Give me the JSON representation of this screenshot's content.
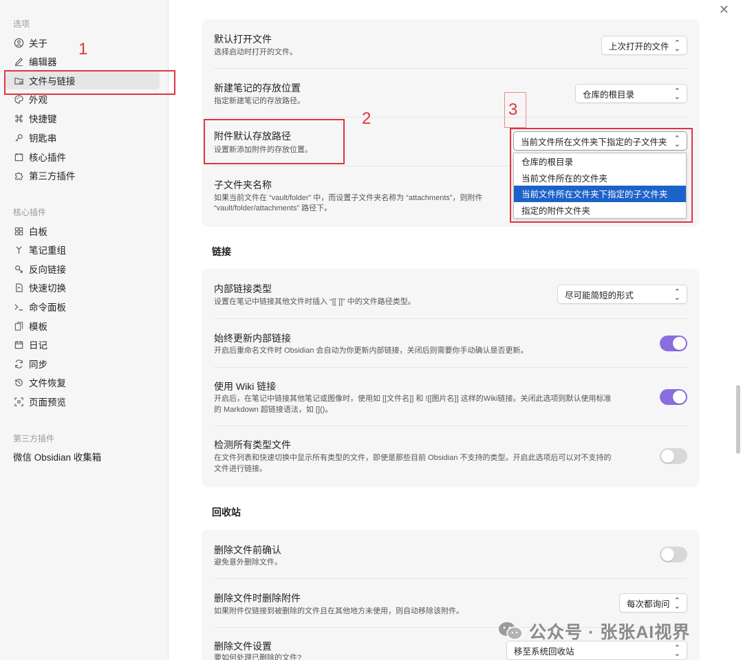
{
  "sidebar": {
    "section_options": "选项",
    "options": [
      {
        "label": "关于",
        "icon": "about-icon"
      },
      {
        "label": "编辑器",
        "icon": "pencil-icon"
      },
      {
        "label": "文件与链接",
        "icon": "folder-link-icon",
        "active": true
      },
      {
        "label": "外观",
        "icon": "palette-icon"
      },
      {
        "label": "快捷键",
        "icon": "command-icon"
      },
      {
        "label": "钥匙串",
        "icon": "key-icon"
      },
      {
        "label": "核心插件",
        "icon": "calendar-box-icon"
      },
      {
        "label": "第三方插件",
        "icon": "puzzle-icon"
      }
    ],
    "section_core": "核心插件",
    "core": [
      {
        "label": "白板",
        "icon": "grid-icon"
      },
      {
        "label": "笔记重组",
        "icon": "merge-icon"
      },
      {
        "label": "反向链接",
        "icon": "backlink-icon"
      },
      {
        "label": "快速切换",
        "icon": "switch-file-icon"
      },
      {
        "label": "命令面板",
        "icon": "terminal-icon"
      },
      {
        "label": "模板",
        "icon": "template-icon"
      },
      {
        "label": "日记",
        "icon": "calendar-icon"
      },
      {
        "label": "同步",
        "icon": "sync-icon"
      },
      {
        "label": "文件恢复",
        "icon": "history-icon"
      },
      {
        "label": "页面预览",
        "icon": "preview-icon"
      }
    ],
    "section_third": "第三方插件",
    "third": [
      {
        "label": "微信 Obsidian 收集箱"
      }
    ]
  },
  "files": {
    "default_open": {
      "title": "默认打开文件",
      "desc": "选择启动时打开的文件。",
      "value": "上次打开的文件"
    },
    "new_note_location": {
      "title": "新建笔记的存放位置",
      "desc": "指定新建笔记的存放路径。",
      "value": "仓库的根目录"
    },
    "attachment_path": {
      "title": "附件默认存放路径",
      "desc": "设置新添加附件的存放位置。",
      "value": "当前文件所在文件夹下指定的子文件夹"
    },
    "subfolder_name": {
      "title": "子文件夹名称",
      "desc_line1": "如果当前文件在 “vault/folder” 中，而设置子文件夹名称为 “attachments”，则附件",
      "desc_line2": "“vault/folder/attachments” 路径下。"
    }
  },
  "attachment_dropdown": {
    "options": [
      "仓库的根目录",
      "当前文件所在的文件夹",
      "当前文件所在文件夹下指定的子文件夹",
      "指定的附件文件夹"
    ],
    "selected_index": 2
  },
  "links": {
    "heading": "链接",
    "internal_link_type": {
      "title": "内部链接类型",
      "desc": "设置在笔记中链接其他文件时插入 “[[ ]]” 中的文件路径类型。",
      "value": "尽可能简短的形式"
    },
    "auto_update": {
      "title": "始终更新内部链接",
      "desc": "开启后重命名文件时 Obsidian 会自动为你更新内部链接，关闭后则需要你手动确认是否更新。",
      "on": true
    },
    "wiki_links": {
      "title": "使用 Wiki 链接",
      "desc_line1": "开启后，在笔记中链接其他笔记或图像时，使用如 [[文件名]] 和 ![[图片名]] 这样的Wiki链接。关闭此选项则默认使用标准",
      "desc_line2": "的 Markdown 超链接语法，如 []()。",
      "on": true
    },
    "detect_all": {
      "title": "检测所有类型文件",
      "desc_line1": "在文件列表和快速切换中显示所有类型的文件，即使是那些目前 Obsidian 不支持的类型。开启此选项后可以对不支持的",
      "desc_line2": "文件进行链接。",
      "on": false
    }
  },
  "trash": {
    "heading": "回收站",
    "confirm_delete": {
      "title": "删除文件前确认",
      "desc": "避免意外删除文件。",
      "on": false
    },
    "delete_attachments": {
      "title": "删除文件时删除附件",
      "desc": "如果附件仅链接到被删除的文件且在其他地方未使用，则自动移除该附件。",
      "value": "每次都询问"
    },
    "delete_setting": {
      "title": "删除文件设置",
      "desc": "要如何处理已删除的文件?",
      "value": "移至系统回收站"
    }
  },
  "annotations": {
    "one": "1",
    "two": "2",
    "three": "3"
  },
  "watermark": {
    "text": "公众号 · 张张AI视界"
  },
  "colors": {
    "accent": "#8a6ee0",
    "highlight_red": "#e0343c",
    "dropdown_selected": "#1d62c9"
  }
}
